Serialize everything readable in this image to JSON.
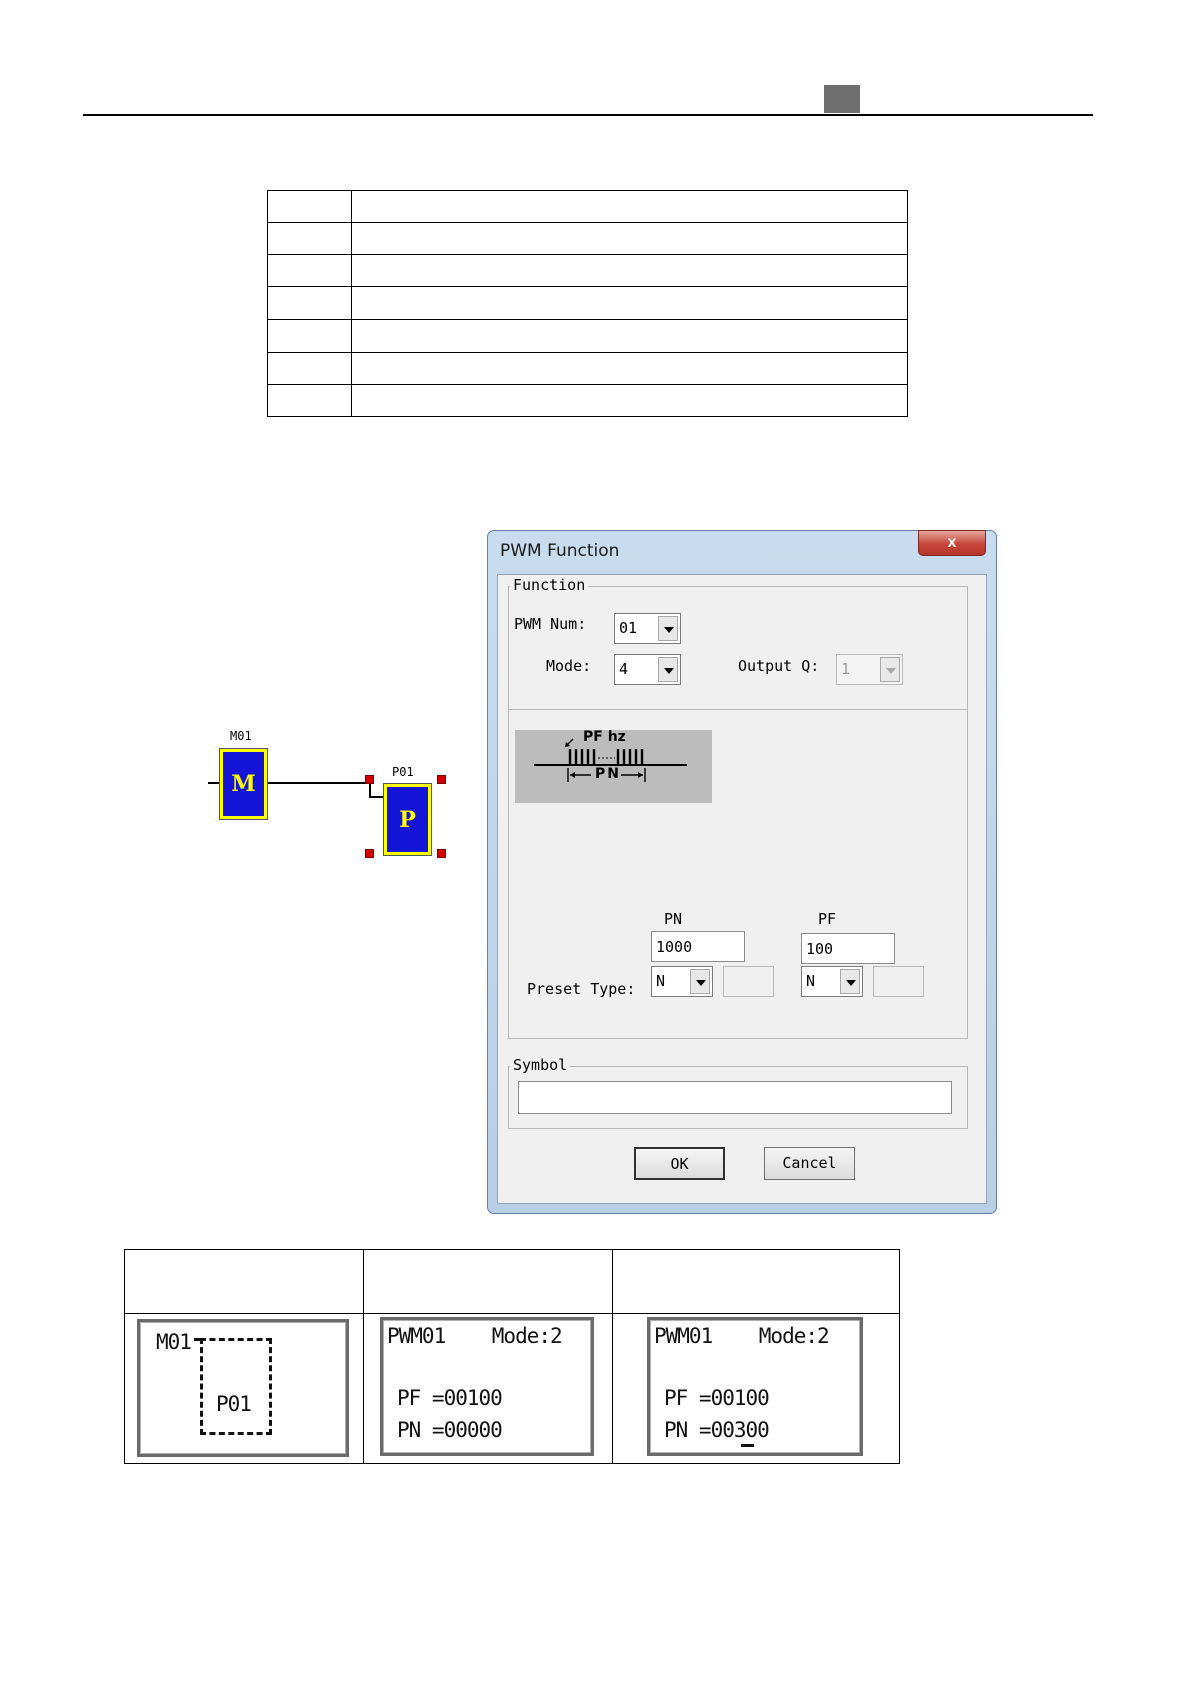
{
  "ladder": {
    "coil_label": "M01",
    "coil_letter": "M",
    "pwm_label": "P01",
    "pwm_letter": "P"
  },
  "dialog": {
    "title": "PWM Function",
    "close_glyph": "x",
    "function_group": {
      "label": "Function",
      "pwm_num_label": "PWM Num:",
      "pwm_num_value": "01",
      "mode_label": "Mode:",
      "mode_value": "4",
      "output_label": "Output Q:",
      "output_value": "1"
    },
    "illustration": {
      "pf_text": "PF hz",
      "pn_text": "PN"
    },
    "pn_header": "PN",
    "pf_header": "PF",
    "pn_value": "1000",
    "pf_value": "100",
    "preset_type_label": "Preset Type:",
    "pn_preset_type": "N",
    "pf_preset_type": "N",
    "symbol_group": {
      "label": "Symbol",
      "value": ""
    },
    "ok_label": "OK",
    "cancel_label": "Cancel"
  },
  "lcd_panels": {
    "panel1": {
      "line1": "M01",
      "line2": "P01"
    },
    "panel2": {
      "line1": "PWM01    Mode:2",
      "line2": "PF =00100",
      "line3": "PN =00000"
    },
    "panel3": {
      "line1": "PWM01    Mode:2",
      "line2": "PF =00100",
      "line3": "PN =00300"
    }
  },
  "colors": {
    "block_fill": "#1515d8",
    "block_text": "#ffff00",
    "handle": "#d40000",
    "close_button": "#c7453a"
  }
}
